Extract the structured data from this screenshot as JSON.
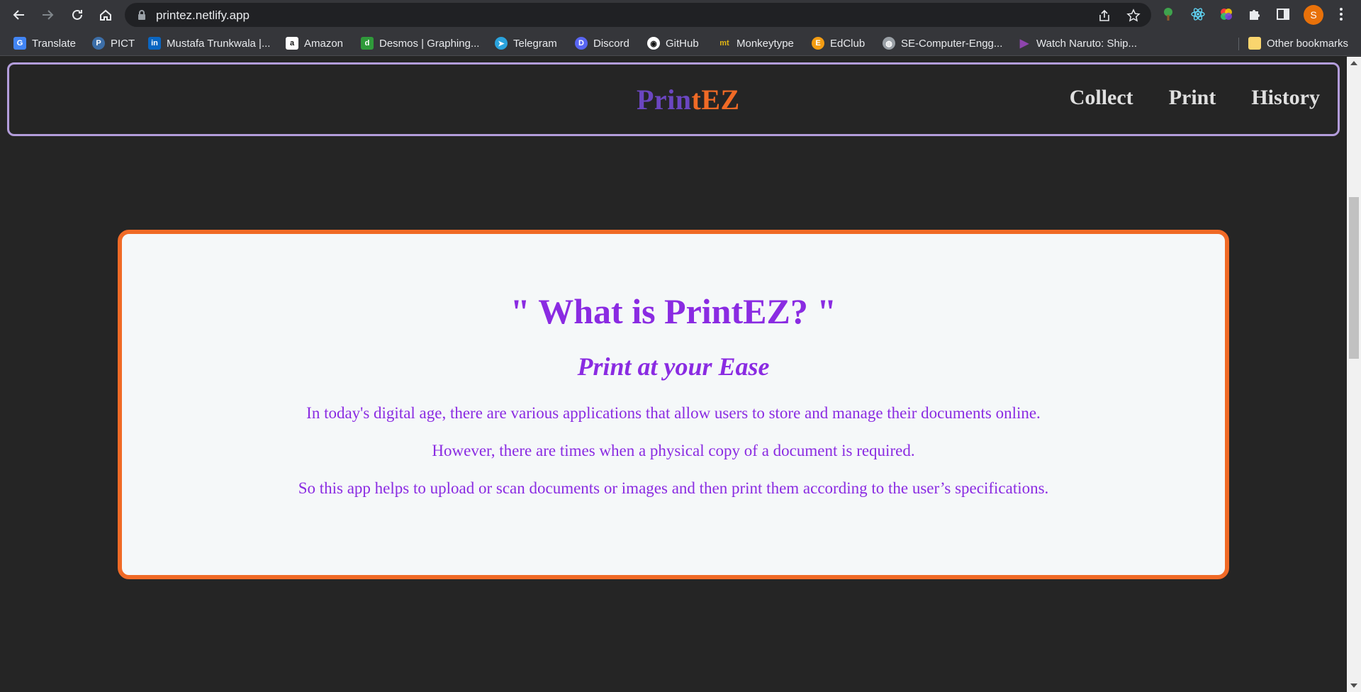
{
  "browser": {
    "url": "printez.netlify.app",
    "profile_initial": "S",
    "bookmarks": [
      {
        "label": "Translate",
        "icon": "google-translate-icon",
        "color": "#4285f4"
      },
      {
        "label": "PICT",
        "icon": "pict-icon",
        "color": "#3c6ea8"
      },
      {
        "label": "Mustafa Trunkwala |...",
        "icon": "linkedin-icon",
        "color": "#0a66c2"
      },
      {
        "label": "Amazon",
        "icon": "amazon-icon",
        "color": "#ffffff"
      },
      {
        "label": "Desmos | Graphing...",
        "icon": "desmos-icon",
        "color": "#2f9a3a"
      },
      {
        "label": "Telegram",
        "icon": "telegram-icon",
        "color": "#2aa3dd"
      },
      {
        "label": "Discord",
        "icon": "discord-icon",
        "color": "#5865f2"
      },
      {
        "label": "GitHub",
        "icon": "github-icon",
        "color": "#ffffff"
      },
      {
        "label": "Monkeytype",
        "icon": "monkeytype-icon",
        "color": "#e2b714"
      },
      {
        "label": "EdClub",
        "icon": "edclub-icon",
        "color": "#f39c12"
      },
      {
        "label": "SE-Computer-Engg...",
        "icon": "globe-icon",
        "color": "#9aa0a6"
      },
      {
        "label": "Watch Naruto: Ship...",
        "icon": "play-icon",
        "color": "#8e44ad"
      }
    ],
    "other_bookmarks": "Other bookmarks"
  },
  "navbar": {
    "logo_part1": "Prin",
    "logo_part2": "tEZ",
    "links": [
      "Collect",
      "Print",
      "History"
    ]
  },
  "colors": {
    "logo_purple": "#6b46c1",
    "accent_orange": "#f06a26",
    "text_purple": "#8a2be2",
    "page_background": "#252525",
    "card_background": "#f5f8f9"
  },
  "card": {
    "title": "\" What is PrintEZ? \"",
    "subtitle": "Print at your Ease",
    "paragraphs": [
      "In today's digital age, there are various applications that allow users to store and manage their documents online.",
      "However, there are times when a physical copy of a document is required.",
      "So this app helps to upload or scan documents or images and then print them according to the user’s specifications."
    ]
  }
}
